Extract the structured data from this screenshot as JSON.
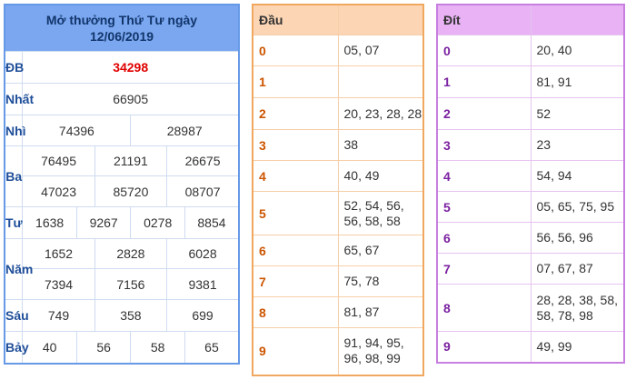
{
  "results": {
    "title_line1": "Mở thưởng Thứ Tư ngày",
    "title_line2": "12/06/2019",
    "db": {
      "label": "ĐB",
      "value": "34298"
    },
    "nhat": {
      "label": "Nhất",
      "value": "66905"
    },
    "nhi": {
      "label": "Nhì",
      "values": [
        "74396",
        "28987"
      ]
    },
    "ba": {
      "label": "Ba",
      "values": [
        "76495",
        "21191",
        "26675",
        "47023",
        "85720",
        "08707"
      ]
    },
    "tu": {
      "label": "Tư",
      "values": [
        "1638",
        "9267",
        "0278",
        "8854"
      ]
    },
    "nam": {
      "label": "Năm",
      "values": [
        "1652",
        "2828",
        "6028",
        "7394",
        "7156",
        "9381"
      ]
    },
    "sau": {
      "label": "Sáu",
      "values": [
        "749",
        "358",
        "699"
      ]
    },
    "bay": {
      "label": "Bảy",
      "values": [
        "40",
        "56",
        "58",
        "65"
      ]
    }
  },
  "dau": {
    "header": "Đầu",
    "rows": [
      {
        "digit": "0",
        "values": "05, 07"
      },
      {
        "digit": "1",
        "values": ""
      },
      {
        "digit": "2",
        "values": "20, 23, 28, 28"
      },
      {
        "digit": "3",
        "values": "38"
      },
      {
        "digit": "4",
        "values": "40, 49"
      },
      {
        "digit": "5",
        "values": "52, 54, 56, 56, 58, 58"
      },
      {
        "digit": "6",
        "values": "65, 67"
      },
      {
        "digit": "7",
        "values": "75, 78"
      },
      {
        "digit": "8",
        "values": "81, 87"
      },
      {
        "digit": "9",
        "values": "91, 94, 95, 96, 98, 99"
      }
    ]
  },
  "dit": {
    "header": "Đít",
    "rows": [
      {
        "digit": "0",
        "values": "20, 40"
      },
      {
        "digit": "1",
        "values": "81, 91"
      },
      {
        "digit": "2",
        "values": "52"
      },
      {
        "digit": "3",
        "values": "23"
      },
      {
        "digit": "4",
        "values": "54, 94"
      },
      {
        "digit": "5",
        "values": "05, 65, 75, 95"
      },
      {
        "digit": "6",
        "values": "56, 56, 96"
      },
      {
        "digit": "7",
        "values": "07, 67, 87"
      },
      {
        "digit": "8",
        "values": "28, 28, 38, 58, 58, 78, 98"
      },
      {
        "digit": "9",
        "values": "49, 99"
      }
    ]
  },
  "colors": {
    "special": "#e00000",
    "results_border": "#6699e6",
    "dau_border": "#f0a860",
    "dit_border": "#c77fe0"
  }
}
